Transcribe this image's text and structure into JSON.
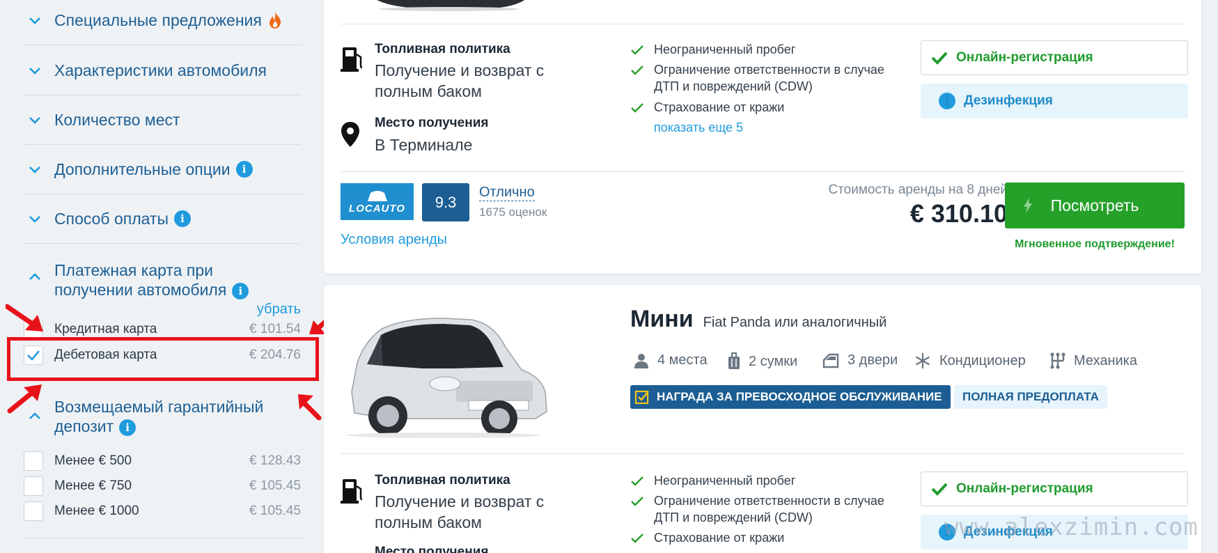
{
  "sidebar": {
    "filters": [
      {
        "label": "Специальные предложения"
      },
      {
        "label": "Характеристики автомобиля"
      },
      {
        "label": "Количество мест"
      },
      {
        "label": "Дополнительные опции"
      },
      {
        "label": "Способ оплаты"
      }
    ],
    "card_section": {
      "label": "Платежная карта при получении автомобиля",
      "reset": "убрать",
      "options": [
        {
          "label": "Кредитная карта",
          "price": "€ 101.54",
          "checked": false
        },
        {
          "label": "Дебетовая карта",
          "price": "€ 204.76",
          "checked": true
        }
      ]
    },
    "deposit_section": {
      "label": "Возмещаемый гарантийный депозит",
      "options": [
        {
          "label": "Менее € 500",
          "price": "€ 128.43"
        },
        {
          "label": "Менее € 750",
          "price": "€ 105.45"
        },
        {
          "label": "Менее € 1000",
          "price": "€ 105.45"
        }
      ]
    }
  },
  "card1": {
    "fuel_title": "Топливная политика",
    "fuel_value": "Получение и возврат с полным баком",
    "pickup_title": "Место получения",
    "pickup_value": "В Терминале",
    "includes": [
      "Неограниченный пробег",
      "Ограничение ответственности в случае ДТП и повреждений (CDW)",
      "Страхование от кражи"
    ],
    "show_more": "показать еще 5",
    "online": "Онлайн-регистрация",
    "disinfection": "Дезинфекция",
    "supplier_logo": "LOCAUTO",
    "score": "9.3",
    "score_word": "Отлично",
    "score_count": "1675 оценок",
    "terms": "Условия аренды",
    "price_label": "Стоимость аренды на 8 дней",
    "price": "€ 310.10",
    "view_button": "Посмотреть",
    "confirm": "Мгновенное подтверждение!"
  },
  "card2": {
    "class": "Мини",
    "model": "Fiat Panda или аналогичный",
    "specs": [
      "4 места",
      "2 сумки",
      "3 двери",
      "Кондиционер",
      "Механика"
    ],
    "badge_award": "НАГРАДА ЗА ПРЕВОСХОДНОЕ ОБСЛУЖИВАНИЕ",
    "badge_prepay": "ПОЛНАЯ ПРЕДОПЛАТА",
    "fuel_title": "Топливная политика",
    "fuel_value": "Получение и возврат с полным баком",
    "pickup_title": "Место получения",
    "includes": [
      "Неограниченный пробег",
      "Ограничение ответственности в случае ДТП и повреждений (CDW)",
      "Страхование от кражи"
    ],
    "online": "Онлайн-регистрация",
    "disinfection": "Дезинфекция"
  },
  "watermark": "www.alexzimin.com",
  "colors": {
    "accent": "#1f9bde",
    "brand_dark": "#1c5e93",
    "green": "#25a12a",
    "highlight": "#e8131a"
  }
}
